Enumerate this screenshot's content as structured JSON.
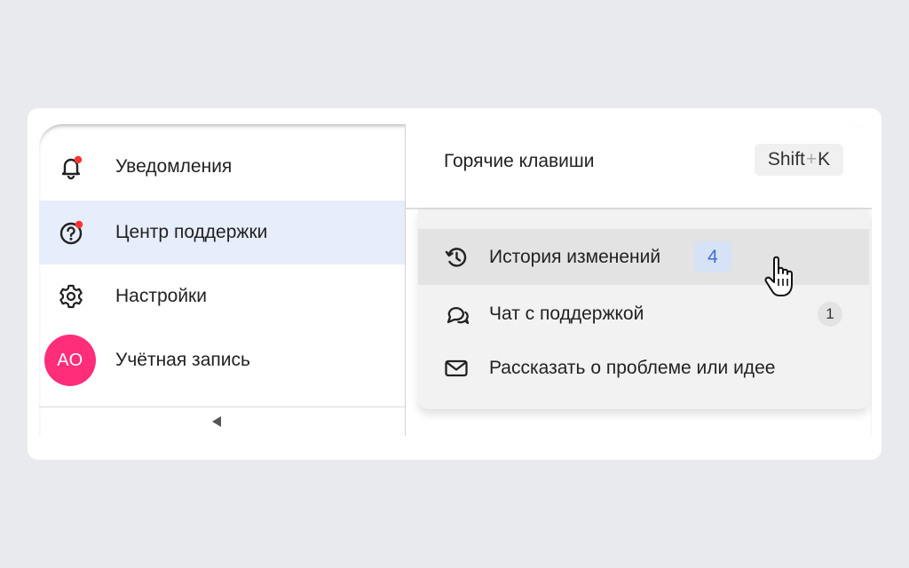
{
  "sidebar": {
    "items": [
      {
        "label": "Уведомления",
        "icon": "bell-icon",
        "has_dot": true
      },
      {
        "label": "Центр поддержки",
        "icon": "help-circle-icon",
        "has_dot": true,
        "active": true
      },
      {
        "label": "Настройки",
        "icon": "gear-icon"
      },
      {
        "label": "Учётная запись",
        "avatar_initials": "АО",
        "avatar_color": "#ff2d7a"
      }
    ],
    "collapse_icon": "triangle-left-icon"
  },
  "hotkeys": {
    "label": "Горячие клавиши",
    "shortcut_key1": "Shift",
    "shortcut_plus": "+",
    "shortcut_key2": "K"
  },
  "menu": {
    "items": [
      {
        "label": "История изменений",
        "icon": "history-icon",
        "badge": "4",
        "badge_color": "#3f6fd1",
        "hovered": true
      },
      {
        "label": "Чат с поддержкой",
        "icon": "chat-icon",
        "badge": "1"
      },
      {
        "label": "Рассказать о проблеме или идее",
        "icon": "mail-icon"
      }
    ]
  },
  "colors": {
    "accent": "#3f6fd1",
    "active_bg": "#e6edfb",
    "notification_dot": "#f33",
    "avatar": "#ff2d7a"
  },
  "cursor": "hand-pointer-icon"
}
